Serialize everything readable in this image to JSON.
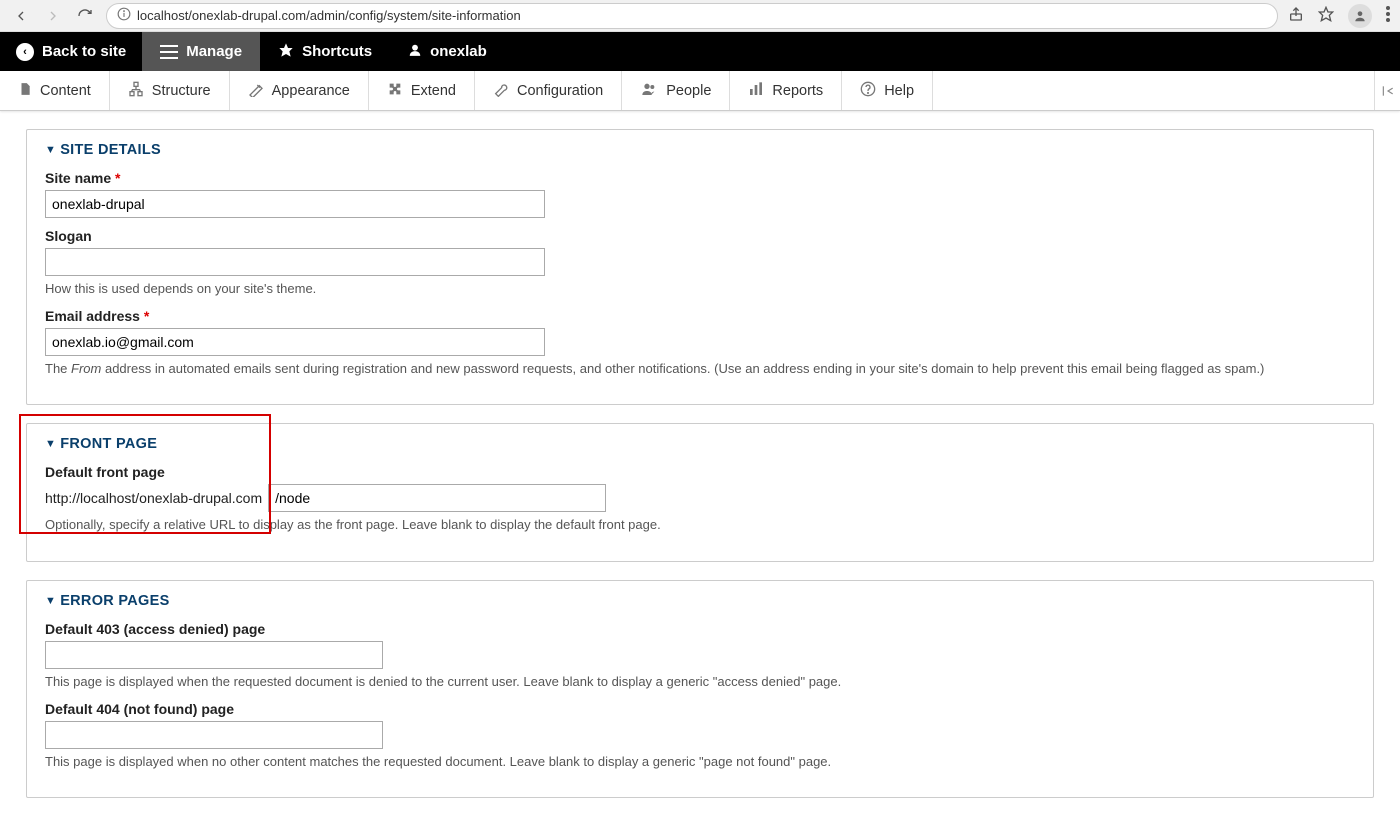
{
  "browser": {
    "url": "localhost/onexlab-drupal.com/admin/config/system/site-information"
  },
  "adminBar": {
    "backToSite": "Back to site",
    "tabs": [
      {
        "label": "Manage"
      },
      {
        "label": "Shortcuts"
      },
      {
        "label": "onexlab"
      }
    ]
  },
  "adminMenu": {
    "items": [
      {
        "label": "Content"
      },
      {
        "label": "Structure"
      },
      {
        "label": "Appearance"
      },
      {
        "label": "Extend"
      },
      {
        "label": "Configuration"
      },
      {
        "label": "People"
      },
      {
        "label": "Reports"
      },
      {
        "label": "Help"
      }
    ]
  },
  "panels": {
    "siteDetails": {
      "title": "SITE DETAILS",
      "siteName": {
        "label": "Site name",
        "value": "onexlab-drupal"
      },
      "slogan": {
        "label": "Slogan",
        "value": "",
        "desc": "How this is used depends on your site's theme."
      },
      "email": {
        "label": "Email address",
        "value": "onexlab.io@gmail.com",
        "descPrefix": "The ",
        "descItalic": "From",
        "descRest": " address in automated emails sent during registration and new password requests, and other notifications. (Use an address ending in your site's domain to help prevent this email being flagged as spam.)"
      }
    },
    "frontPage": {
      "title": "FRONT PAGE",
      "label": "Default front page",
      "prefix": "http://localhost/onexlab-drupal.com",
      "value": "/node",
      "desc": "Optionally, specify a relative URL to display as the front page. Leave blank to display the default front page."
    },
    "errorPages": {
      "title": "ERROR PAGES",
      "p403": {
        "label": "Default 403 (access denied) page",
        "value": "",
        "desc": "This page is displayed when the requested document is denied to the current user. Leave blank to display a generic \"access denied\" page."
      },
      "p404": {
        "label": "Default 404 (not found) page",
        "value": "",
        "desc": "This page is displayed when no other content matches the requested document. Leave blank to display a generic \"page not found\" page."
      }
    }
  }
}
